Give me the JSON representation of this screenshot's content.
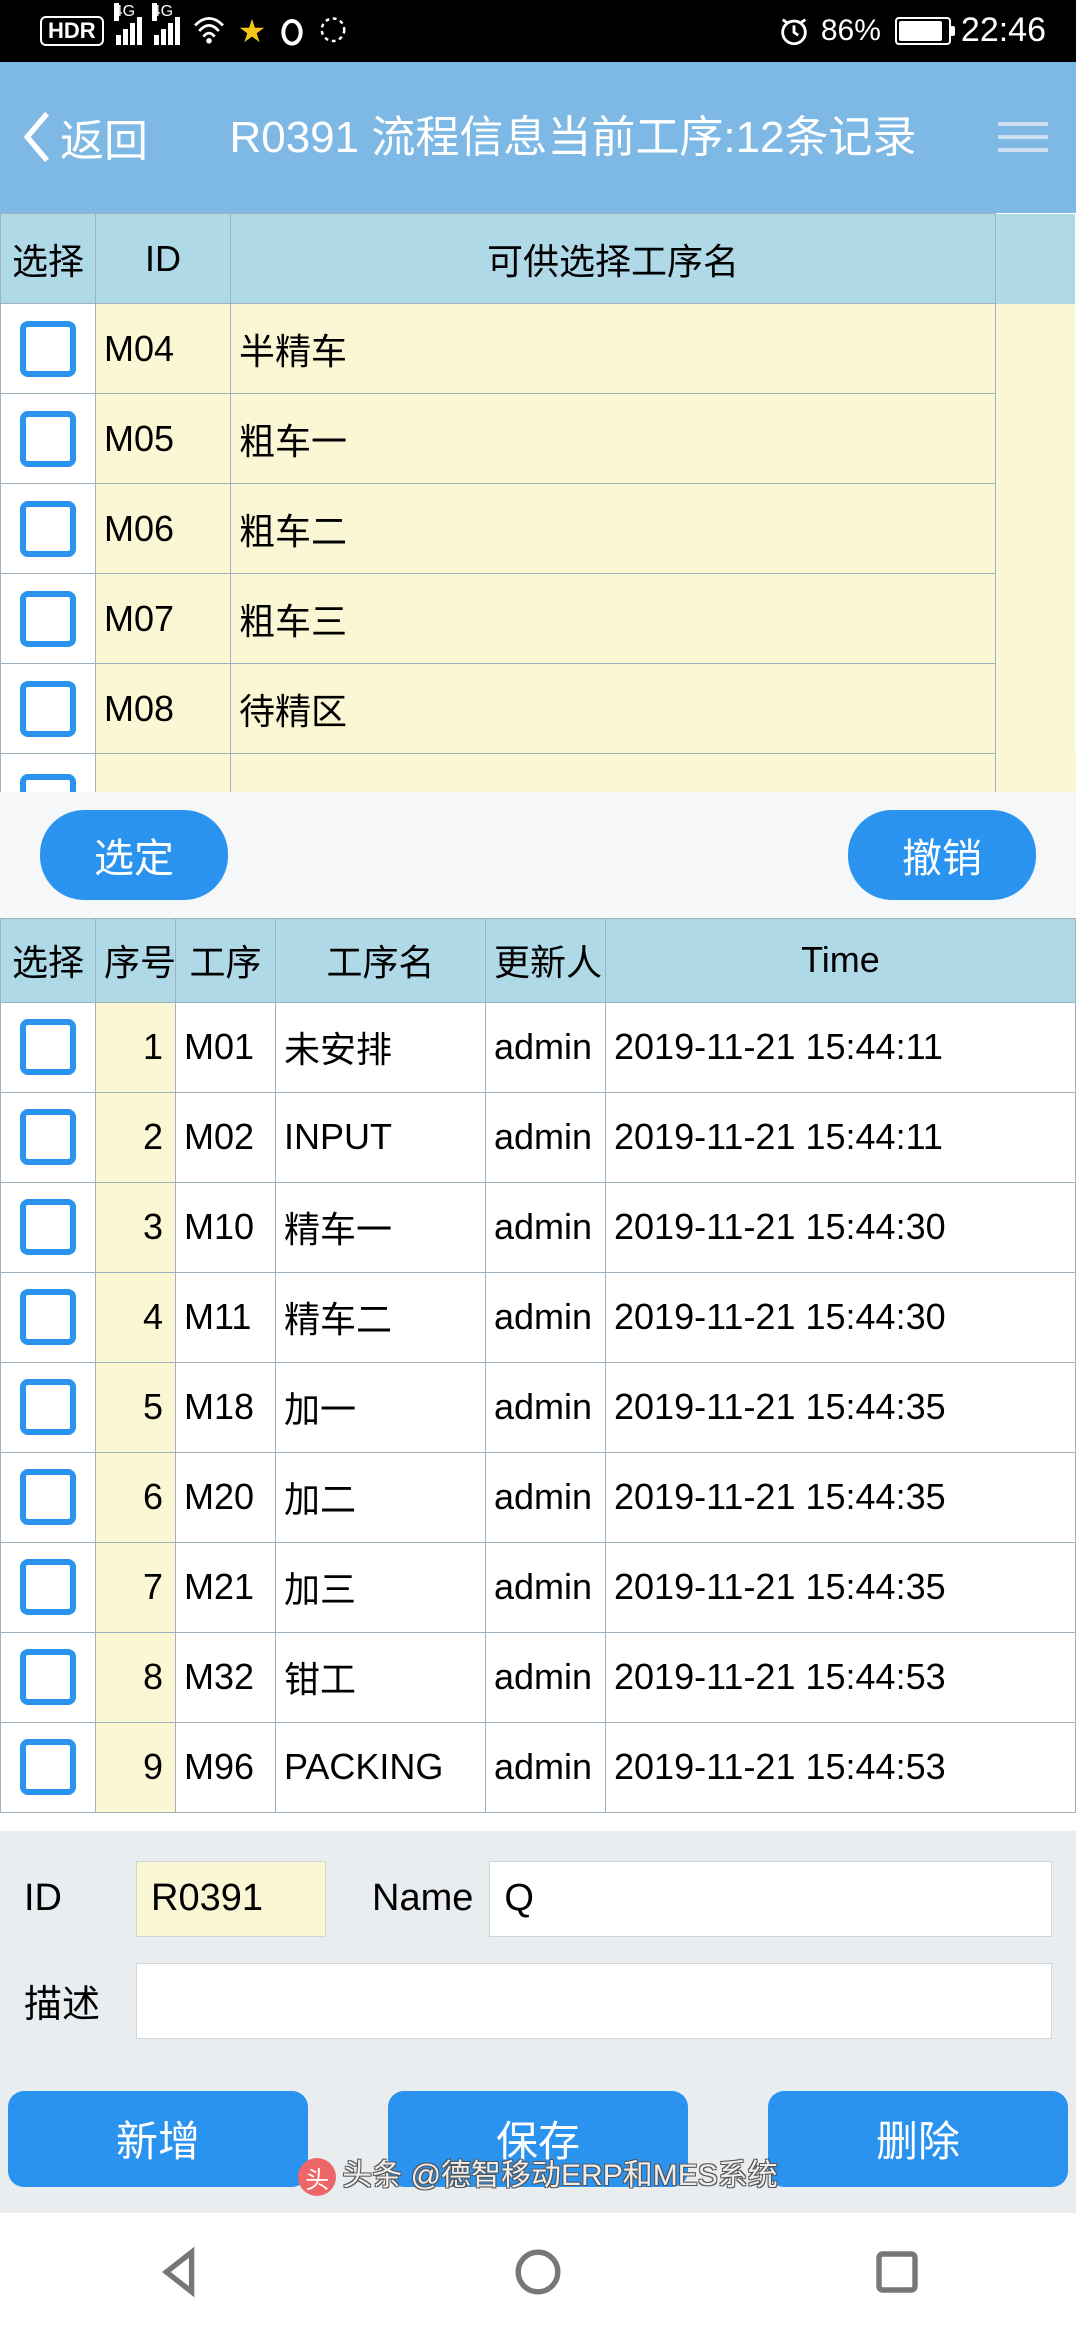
{
  "status": {
    "hd": "HDR",
    "net1": "4G",
    "net2": "4G",
    "battery_pct": "86%",
    "time": "22:46"
  },
  "header": {
    "back_label": "返回",
    "title": "R0391 流程信息当前工序:12条记录"
  },
  "table_avail": {
    "headers": {
      "select": "选择",
      "id": "ID",
      "name": "可供选择工序名"
    },
    "rows": [
      {
        "id": "M04",
        "name": "半精车"
      },
      {
        "id": "M05",
        "name": "粗车一"
      },
      {
        "id": "M06",
        "name": "粗车二"
      },
      {
        "id": "M07",
        "name": "粗车三"
      },
      {
        "id": "M08",
        "name": "待精区"
      }
    ]
  },
  "buttons": {
    "select": "选定",
    "undo": "撤销"
  },
  "table_sel": {
    "headers": {
      "select": "选择",
      "seq": "序号",
      "proc": "工序",
      "pname": "工序名",
      "user": "更新人",
      "time": "Time"
    },
    "rows": [
      {
        "seq": "1",
        "proc": "M01",
        "pname": "未安排",
        "user": "admin",
        "time": "2019-11-21 15:44:11"
      },
      {
        "seq": "2",
        "proc": "M02",
        "pname": "INPUT",
        "user": "admin",
        "time": "2019-11-21 15:44:11"
      },
      {
        "seq": "3",
        "proc": "M10",
        "pname": "精车一",
        "user": "admin",
        "time": "2019-11-21 15:44:30"
      },
      {
        "seq": "4",
        "proc": "M11",
        "pname": "精车二",
        "user": "admin",
        "time": "2019-11-21 15:44:30"
      },
      {
        "seq": "5",
        "proc": "M18",
        "pname": "加一",
        "user": "admin",
        "time": "2019-11-21 15:44:35"
      },
      {
        "seq": "6",
        "proc": "M20",
        "pname": "加二",
        "user": "admin",
        "time": "2019-11-21 15:44:35"
      },
      {
        "seq": "7",
        "proc": "M21",
        "pname": "加三",
        "user": "admin",
        "time": "2019-11-21 15:44:35"
      },
      {
        "seq": "8",
        "proc": "M32",
        "pname": "钳工",
        "user": "admin",
        "time": "2019-11-21 15:44:53"
      },
      {
        "seq": "9",
        "proc": "M96",
        "pname": "PACKING",
        "user": "admin",
        "time": "2019-11-21 15:44:53"
      }
    ]
  },
  "form": {
    "id_label": "ID",
    "id_value": "R0391",
    "name_label": "Name",
    "name_value": "Q",
    "desc_label": "描述",
    "desc_value": ""
  },
  "actions": {
    "add": "新增",
    "save": "保存",
    "delete": "删除"
  },
  "watermark": {
    "prefix": "头条",
    "author": "@德智移动ERP和MES系统"
  }
}
